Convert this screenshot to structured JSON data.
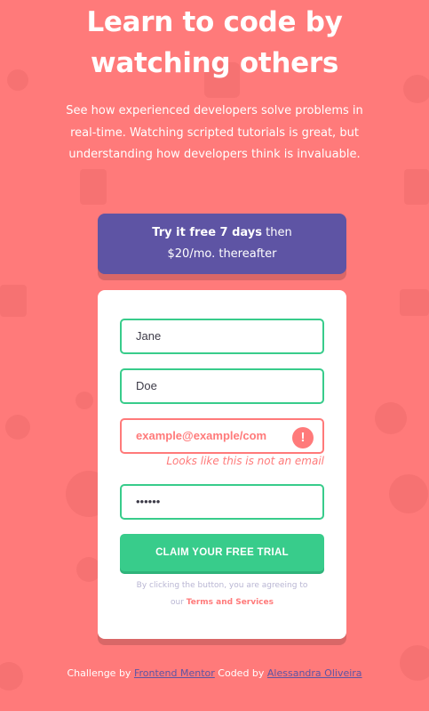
{
  "hero": {
    "title_line1": "Learn to code by",
    "title_line2": "watching others",
    "description": "See how experienced developers solve problems in real-time. Watching scripted tutorials is great, but understanding how developers think is invaluable."
  },
  "promo": {
    "bold": "Try it free 7 days",
    "rest_line1": " then",
    "line2": "$20/mo. thereafter"
  },
  "form": {
    "first_name_value": "Jane",
    "last_name_value": "Doe",
    "email_value": "example@example/com",
    "email_error_icon": "!",
    "email_error_message": "Looks like this is not an email",
    "password_value": "••••••",
    "submit_label": "CLAIM YOUR FREE TRIAL",
    "terms_line1": "By clicking the button, you are agreeing to",
    "terms_our": "our ",
    "terms_link": "Terms and Services"
  },
  "footer": {
    "challenge_prefix": "Challenge by ",
    "challenge_link": "Frontend Mentor",
    "coded_prefix": " Coded by ",
    "coded_link": "Alessandra Oliveira"
  },
  "colors": {
    "background": "#ff7a7a",
    "promo_bg": "#5e54a4",
    "accent_green": "#38cc8b",
    "error_red": "#ff7a7a"
  },
  "icons": {
    "error": "error-exclamation-icon"
  }
}
